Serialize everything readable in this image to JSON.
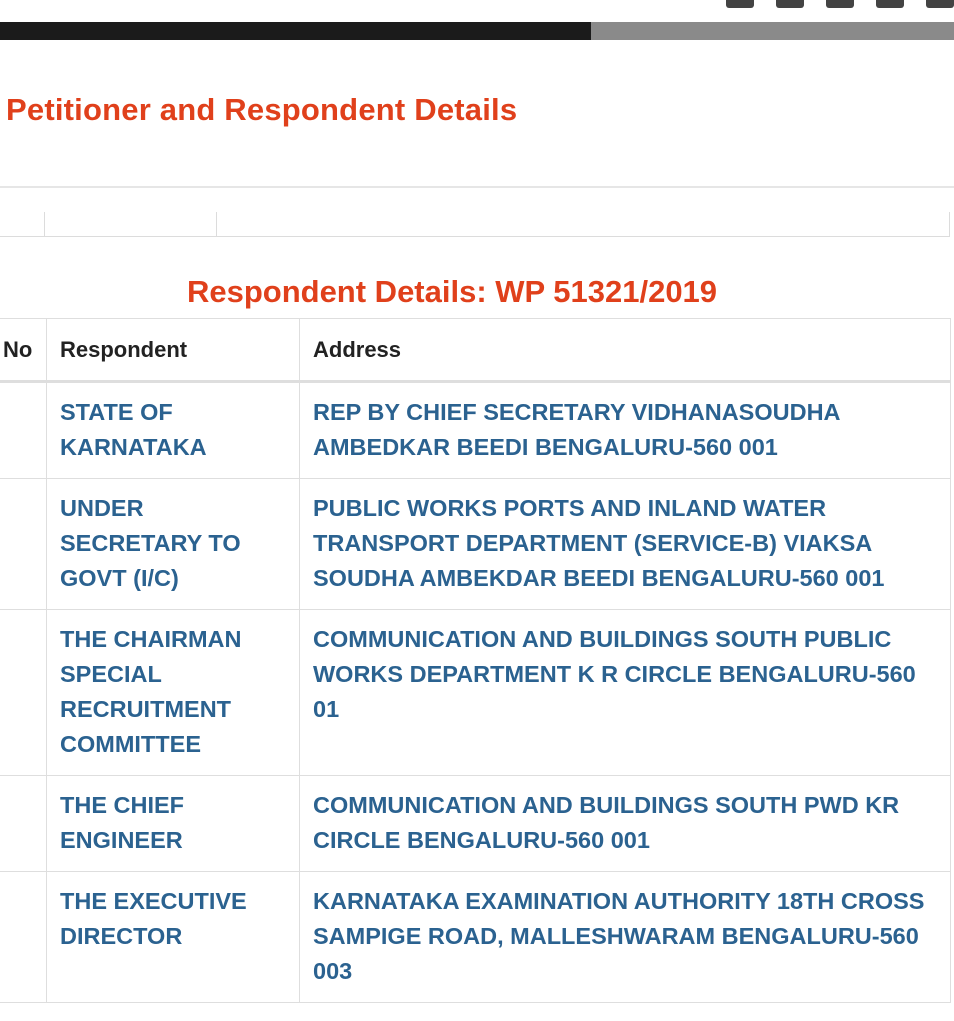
{
  "section_title": "Petitioner and Respondent Details",
  "respondent_title": "Respondent Details: WP 51321/2019",
  "table": {
    "headers": {
      "no": "No",
      "respondent": "Respondent",
      "address": "Address"
    },
    "rows": [
      {
        "no": "",
        "respondent": "STATE OF KARNATAKA",
        "address": "REP BY CHIEF SECRETARY VIDHANASOUDHA AMBEDKAR BEEDI BENGALURU-560 001"
      },
      {
        "no": "",
        "respondent": "UNDER SECRETARY TO GOVT (I/C)",
        "address": "PUBLIC WORKS PORTS AND INLAND WATER TRANSPORT DEPARTMENT (SERVICE-B) VIAKSA SOUDHA AMBEKDAR BEEDI BENGALURU-560 001"
      },
      {
        "no": "",
        "respondent": "THE CHAIRMAN SPECIAL RECRUITMENT COMMITTEE",
        "address": "COMMUNICATION AND BUILDINGS SOUTH PUBLIC WORKS DEPARTMENT K R CIRCLE BENGALURU-560 01"
      },
      {
        "no": "",
        "respondent": "THE CHIEF ENGINEER",
        "address": "COMMUNICATION AND BUILDINGS SOUTH PWD KR CIRCLE BENGALURU-560 001"
      },
      {
        "no": "",
        "respondent": "THE EXECUTIVE DIRECTOR",
        "address": "KARNATAKA EXAMINATION AUTHORITY 18TH CROSS SAMPIGE ROAD, MALLESHWARAM BENGALURU-560 003"
      }
    ]
  },
  "colors": {
    "heading": "#e0401b",
    "link_text": "#2b6290",
    "border": "#dedede"
  },
  "page_load_progress": 0.62
}
